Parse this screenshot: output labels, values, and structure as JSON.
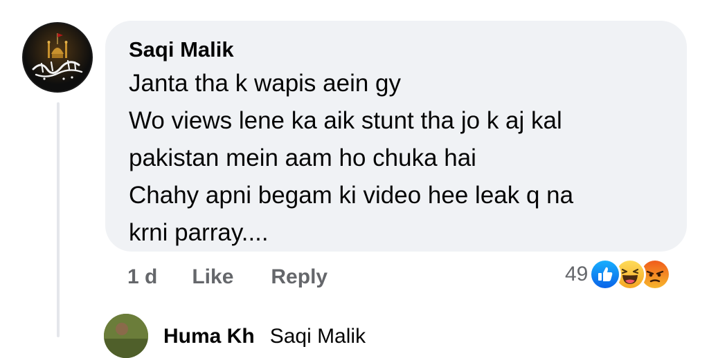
{
  "comment": {
    "author": "Saqi Malik",
    "lines": [
      "Janta tha k wapis aein gy",
      "Wo views lene ka aik stunt tha jo k aj kal",
      "pakistan mein aam ho chuka hai",
      "Chahy apni begam ki video hee leak q na",
      "krni parray...."
    ],
    "avatar_icon": "calligraphy-shrine-avatar"
  },
  "actions": {
    "time": "1 d",
    "like": "Like",
    "reply": "Reply"
  },
  "reactions": {
    "count": "49",
    "icons": [
      "like-reaction-icon",
      "haha-reaction-icon",
      "angry-reaction-icon"
    ],
    "colors": {
      "like": "#1877f2",
      "haha": "#f7b125",
      "angry": "#e9710f"
    }
  },
  "reply_preview": {
    "name": "Huma Kh",
    "tag": "Saqi Malik"
  }
}
